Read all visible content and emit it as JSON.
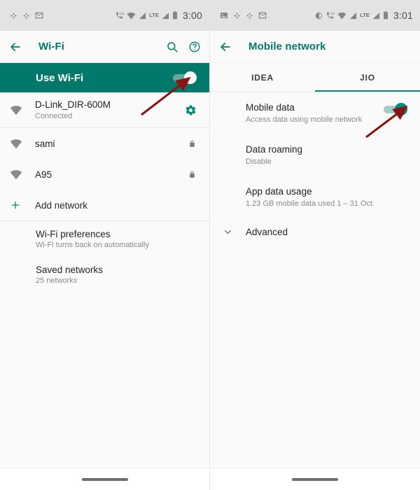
{
  "wifi_panel": {
    "statusbar": {
      "left_icons": [
        "app-icon",
        "app-icon-2",
        "message-icon"
      ],
      "right_icons": [
        "call-lte-icon",
        "wifi-icon",
        "signal-icon",
        "lte-label",
        "signal-2-icon",
        "battery-icon"
      ],
      "lte_label": "LTE",
      "time": "3:00"
    },
    "toolbar": {
      "back_icon": "back-arrow-icon",
      "title": "Wi-Fi",
      "search_icon": "search-icon",
      "help_icon": "help-icon"
    },
    "master_switch": {
      "label": "Use Wi-Fi",
      "state": "on"
    },
    "networks": [
      {
        "name": "D-Link_DIR-600M",
        "status": "Connected",
        "icon": "wifi-signal-icon",
        "end_icon": "gear-icon"
      },
      {
        "name": "sami",
        "status": "",
        "icon": "wifi-signal-icon",
        "end_icon": "lock-icon"
      },
      {
        "name": "A95",
        "status": "",
        "icon": "wifi-signal-icon",
        "end_icon": "lock-icon"
      }
    ],
    "add_network": {
      "label": "Add network",
      "icon": "plus-icon"
    },
    "preferences": [
      {
        "title": "Wi-Fi preferences",
        "subtitle": "Wi-Fi turns back on automatically"
      },
      {
        "title": "Saved networks",
        "subtitle": "25 networks"
      }
    ],
    "navbar": {
      "pill": "home-pill"
    }
  },
  "mobile_panel": {
    "statusbar": {
      "left_icons": [
        "photo-icon",
        "app-icon",
        "app-icon-2",
        "message-icon"
      ],
      "right_icons": [
        "contrast-icon",
        "call-lte-icon",
        "wifi-icon",
        "signal-icon",
        "lte-label",
        "signal-2-icon",
        "battery-icon"
      ],
      "lte_label": "LTE",
      "time": "3:01"
    },
    "toolbar": {
      "back_icon": "back-arrow-icon",
      "title": "Mobile network"
    },
    "tabs": [
      {
        "label": "IDEA",
        "active": false
      },
      {
        "label": "JIO",
        "active": true
      }
    ],
    "settings": [
      {
        "title": "Mobile data",
        "subtitle": "Access data using mobile network",
        "toggle": "on"
      },
      {
        "title": "Data roaming",
        "subtitle": "Disable",
        "toggle": null
      },
      {
        "title": "App data usage",
        "subtitle": "1.23 GB mobile data used 1 – 31 Oct",
        "toggle": null
      }
    ],
    "advanced": {
      "label": "Advanced",
      "icon": "chevron-down-icon"
    },
    "navbar": {
      "pill": "home-pill"
    }
  },
  "annotations": {
    "arrow_color": "#8b1515",
    "arrows": [
      {
        "name": "arrow-to-wifi-toggle",
        "target": "Use Wi-Fi toggle"
      },
      {
        "name": "arrow-to-mobile-data-toggle",
        "target": "Mobile data toggle"
      }
    ]
  }
}
